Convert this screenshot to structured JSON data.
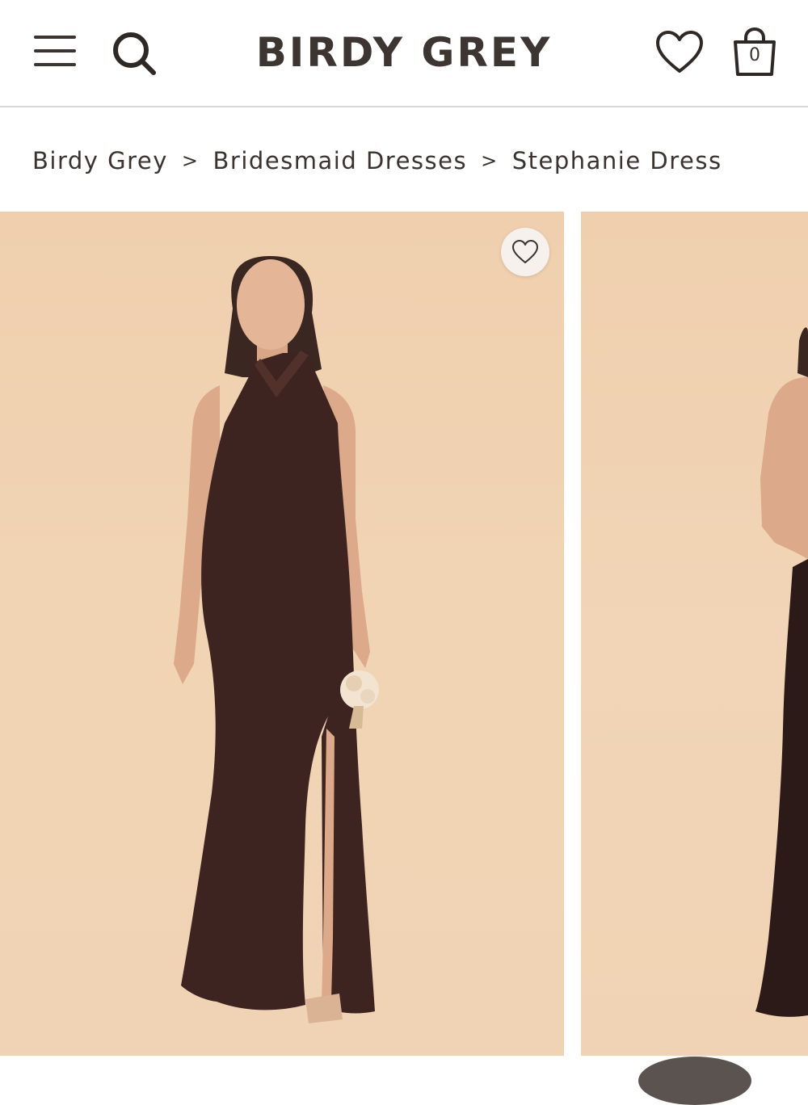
{
  "header": {
    "logo_text": "BIRDY GREY",
    "menu_icon": "hamburger-menu-icon",
    "search_icon": "search-icon",
    "wishlist_icon": "heart-icon",
    "bag_icon": "shopping-bag-icon",
    "bag_count": "0"
  },
  "breadcrumb": {
    "items": [
      {
        "label": "Birdy Grey"
      },
      {
        "label": "Bridesmaid Dresses"
      },
      {
        "label": "Stephanie Dress"
      }
    ],
    "separator": ">"
  },
  "gallery": {
    "favorite_icon": "heart-outline-icon",
    "background_color": "#efd2b2",
    "dress_color": "#3e2420"
  }
}
